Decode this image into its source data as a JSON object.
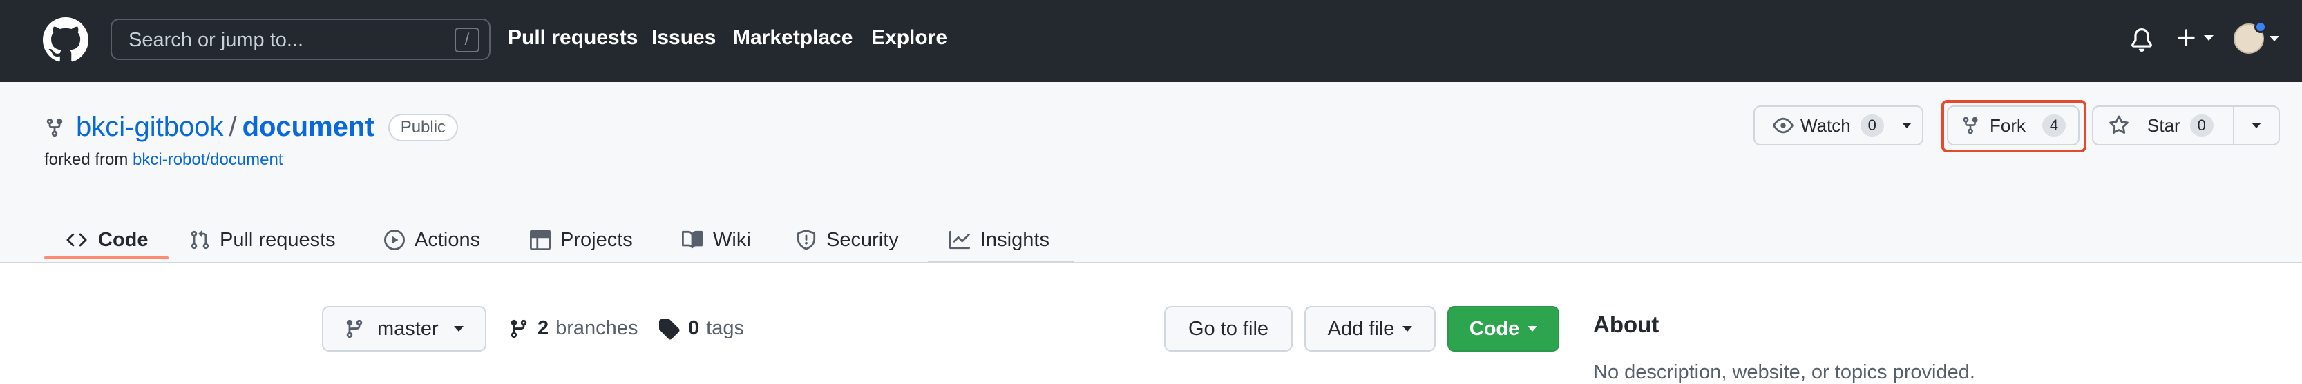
{
  "header": {
    "search_placeholder": "Search or jump to...",
    "search_shortcut": "/",
    "nav": [
      "Pull requests",
      "Issues",
      "Marketplace",
      "Explore"
    ]
  },
  "repo": {
    "owner": "bkci-gitbook",
    "separator": "/",
    "name": "document",
    "visibility": "Public",
    "forked_prefix": "forked from ",
    "forked_from": "bkci-robot/document",
    "actions": {
      "watch_label": "Watch",
      "watch_count": "0",
      "fork_label": "Fork",
      "fork_count": "4",
      "star_label": "Star",
      "star_count": "0"
    },
    "tabs": [
      "Code",
      "Pull requests",
      "Actions",
      "Projects",
      "Wiki",
      "Security",
      "Insights"
    ]
  },
  "main": {
    "branch": "master",
    "branches_count": "2",
    "branches_label": "branches",
    "tags_count": "0",
    "tags_label": "tags",
    "go_to_file": "Go to file",
    "add_file": "Add file",
    "code_button": "Code",
    "about_title": "About",
    "about_desc": "No description, website, or topics provided."
  },
  "colors": {
    "header_bg": "#24292f",
    "link": "#0969da",
    "code_button_bg": "#2da44e",
    "highlight": "#e64a2e",
    "active_tab_underline": "#fd8c73"
  }
}
